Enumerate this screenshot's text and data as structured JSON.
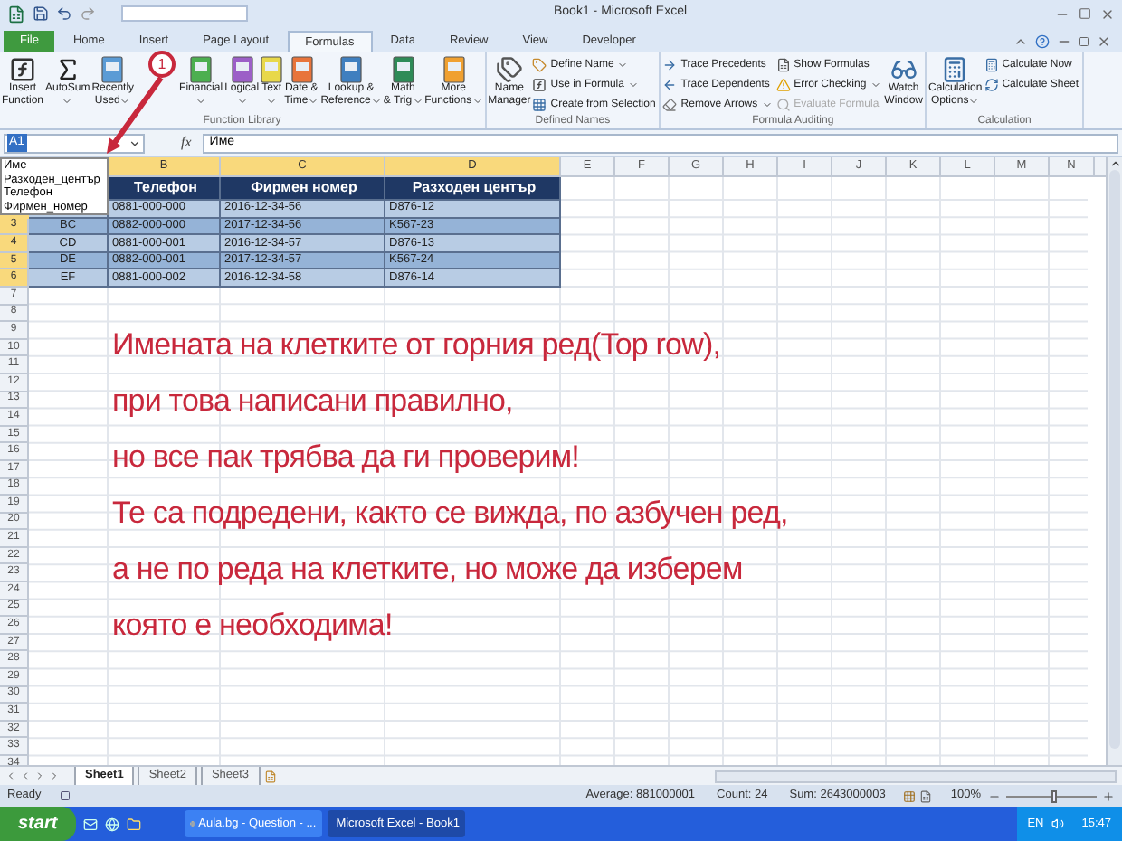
{
  "window": {
    "title": "Book1 - Microsoft Excel"
  },
  "ribbon_tabs": [
    {
      "label": "File",
      "kind": "file",
      "selected": false
    },
    {
      "label": "Home",
      "kind": "tab",
      "selected": false
    },
    {
      "label": "Insert",
      "kind": "tab",
      "selected": false
    },
    {
      "label": "Page Layout",
      "kind": "tab",
      "selected": false
    },
    {
      "label": "Formulas",
      "kind": "tab",
      "selected": true
    },
    {
      "label": "Data",
      "kind": "tab",
      "selected": false
    },
    {
      "label": "Review",
      "kind": "tab",
      "selected": false
    },
    {
      "label": "View",
      "kind": "tab",
      "selected": false
    },
    {
      "label": "Developer",
      "kind": "tab",
      "selected": false
    }
  ],
  "ribbon_groups": [
    {
      "title": "Function Library",
      "items": [
        {
          "kind": "large",
          "label": "Insert\nFunction",
          "dropdown": false,
          "disabled": false
        },
        {
          "kind": "large",
          "label": "AutoSum",
          "dropdown": true,
          "disabled": false
        },
        {
          "kind": "large",
          "label": "Recently\nUsed",
          "dropdown": true,
          "disabled": false
        },
        {
          "kind": "large",
          "label": "Financial",
          "dropdown": true,
          "disabled": false
        },
        {
          "kind": "large",
          "label": "Logical",
          "dropdown": true,
          "disabled": false
        },
        {
          "kind": "large",
          "label": "Text",
          "dropdown": true,
          "disabled": false
        },
        {
          "kind": "large",
          "label": "Date &\nTime",
          "dropdown": true,
          "disabled": false
        },
        {
          "kind": "large",
          "label": "Lookup &\nReference",
          "dropdown": true,
          "disabled": false
        },
        {
          "kind": "large",
          "label": "Math\n& Trig",
          "dropdown": true,
          "disabled": false
        },
        {
          "kind": "large",
          "label": "More\nFunctions",
          "dropdown": true,
          "disabled": false
        }
      ]
    },
    {
      "title": "Defined Names",
      "items": [
        {
          "kind": "large",
          "label": "Name\nManager",
          "dropdown": false,
          "disabled": false
        },
        {
          "kind": "column",
          "items": [
            {
              "label": "Define Name",
              "dropdown": true,
              "disabled": false
            },
            {
              "label": "Use in Formula",
              "dropdown": true,
              "disabled": false
            },
            {
              "label": "Create from Selection",
              "dropdown": false,
              "disabled": false
            }
          ]
        }
      ]
    },
    {
      "title": "Formula Auditing",
      "items": [
        {
          "kind": "column",
          "items": [
            {
              "label": "Trace Precedents",
              "dropdown": false,
              "disabled": false
            },
            {
              "label": "Trace Dependents",
              "dropdown": false,
              "disabled": false
            },
            {
              "label": "Remove Arrows",
              "dropdown": true,
              "disabled": false
            }
          ]
        },
        {
          "kind": "column",
          "items": [
            {
              "label": "Show Formulas",
              "dropdown": false,
              "disabled": false
            },
            {
              "label": "Error Checking",
              "dropdown": true,
              "disabled": false
            },
            {
              "label": "Evaluate Formula",
              "dropdown": false,
              "disabled": true
            }
          ]
        },
        {
          "kind": "large",
          "label": "Watch\nWindow",
          "dropdown": false,
          "disabled": false
        }
      ]
    },
    {
      "title": "Calculation",
      "items": [
        {
          "kind": "large",
          "label": "Calculation\nOptions",
          "dropdown": true,
          "disabled": false
        },
        {
          "kind": "column",
          "items": [
            {
              "label": "Calculate Now",
              "dropdown": false,
              "disabled": false
            },
            {
              "label": "Calculate Sheet",
              "dropdown": false,
              "disabled": false
            }
          ]
        }
      ]
    }
  ],
  "formula_bar": {
    "name_box": "A1",
    "function_button": "fx",
    "value": "Име"
  },
  "name_list": [
    "Име",
    "Разходен_център",
    "Телефон",
    "Фирмен_номер"
  ],
  "columns": [
    {
      "label": "B",
      "selected": true
    },
    {
      "label": "C",
      "selected": true
    },
    {
      "label": "D",
      "selected": true
    },
    {
      "label": "E",
      "selected": false
    },
    {
      "label": "F",
      "selected": false
    },
    {
      "label": "G",
      "selected": false
    },
    {
      "label": "H",
      "selected": false
    },
    {
      "label": "I",
      "selected": false
    },
    {
      "label": "J",
      "selected": false
    },
    {
      "label": "K",
      "selected": false
    },
    {
      "label": "L",
      "selected": false
    },
    {
      "label": "M",
      "selected": false
    },
    {
      "label": "N",
      "selected": false
    }
  ],
  "table_rows": [
    {
      "kind": "header",
      "cells": [
        "Телефон",
        "Фирмен номер",
        "Разходен център"
      ]
    },
    {
      "kind": "data",
      "cells": [
        "0881-000-000",
        "2016-12-34-56",
        "D876-12"
      ]
    },
    {
      "kind": "data",
      "first": "BC",
      "cells": [
        "0882-000-000",
        "2017-12-34-56",
        "K567-23"
      ]
    },
    {
      "kind": "data",
      "first": "CD",
      "cells": [
        "0881-000-001",
        "2016-12-34-57",
        "D876-13"
      ]
    },
    {
      "kind": "data",
      "first": "DE",
      "cells": [
        "0882-000-001",
        "2017-12-34-57",
        "K567-24"
      ]
    },
    {
      "kind": "data",
      "first": "EF",
      "cells": [
        "0881-000-002",
        "2016-12-34-58",
        "D876-14"
      ]
    }
  ],
  "row_headers": [
    {
      "label": "3",
      "selected": true
    },
    {
      "label": "4",
      "selected": true
    },
    {
      "label": "5",
      "selected": true
    },
    {
      "label": "6",
      "selected": true
    },
    {
      "label": "7",
      "selected": false
    },
    {
      "label": "8",
      "selected": false
    },
    {
      "label": "9",
      "selected": false
    },
    {
      "label": "10",
      "selected": false
    },
    {
      "label": "11",
      "selected": false
    },
    {
      "label": "12",
      "selected": false
    },
    {
      "label": "13",
      "selected": false
    },
    {
      "label": "14",
      "selected": false
    },
    {
      "label": "15",
      "selected": false
    },
    {
      "label": "16",
      "selected": false
    },
    {
      "label": "17",
      "selected": false
    },
    {
      "label": "18",
      "selected": false
    },
    {
      "label": "19",
      "selected": false
    },
    {
      "label": "20",
      "selected": false
    },
    {
      "label": "21",
      "selected": false
    },
    {
      "label": "22",
      "selected": false
    },
    {
      "label": "23",
      "selected": false
    },
    {
      "label": "24",
      "selected": false
    },
    {
      "label": "25",
      "selected": false
    },
    {
      "label": "26",
      "selected": false
    },
    {
      "label": "27",
      "selected": false
    },
    {
      "label": "28",
      "selected": false
    },
    {
      "label": "29",
      "selected": false
    },
    {
      "label": "30",
      "selected": false
    },
    {
      "label": "31",
      "selected": false
    },
    {
      "label": "32",
      "selected": false
    },
    {
      "label": "33",
      "selected": false
    },
    {
      "label": "34",
      "selected": false
    }
  ],
  "annotation": {
    "step": "1",
    "lines": [
      "Имената на клетките от горния ред(Top row),",
      "при това написани правилно,",
      "но все пак трябва да ги проверим!",
      "Те са подредени, както се вижда, по азбучен ред,",
      "а не по реда на клетките, но може да изберем",
      "която е необходима!"
    ]
  },
  "sheet_tabs": [
    {
      "label": "Sheet1",
      "selected": true
    },
    {
      "label": "Sheet2",
      "selected": false
    },
    {
      "label": "Sheet3",
      "selected": false
    }
  ],
  "status_bar": {
    "status": "Ready",
    "average": "Average: 881000001",
    "count": "Count: 24",
    "sum": "Sum: 2643000003",
    "zoom": "100%",
    "zoom_slider": {
      "level": 0.5
    }
  },
  "taskbar": {
    "start": "start",
    "tasks": [
      {
        "label": "Aula.bg - Question - ...",
        "kind": "browser",
        "selected": false
      },
      {
        "label": "Microsoft Excel - Book1",
        "kind": "excel",
        "selected": true
      }
    ],
    "language": "EN",
    "clock": "15:47"
  }
}
